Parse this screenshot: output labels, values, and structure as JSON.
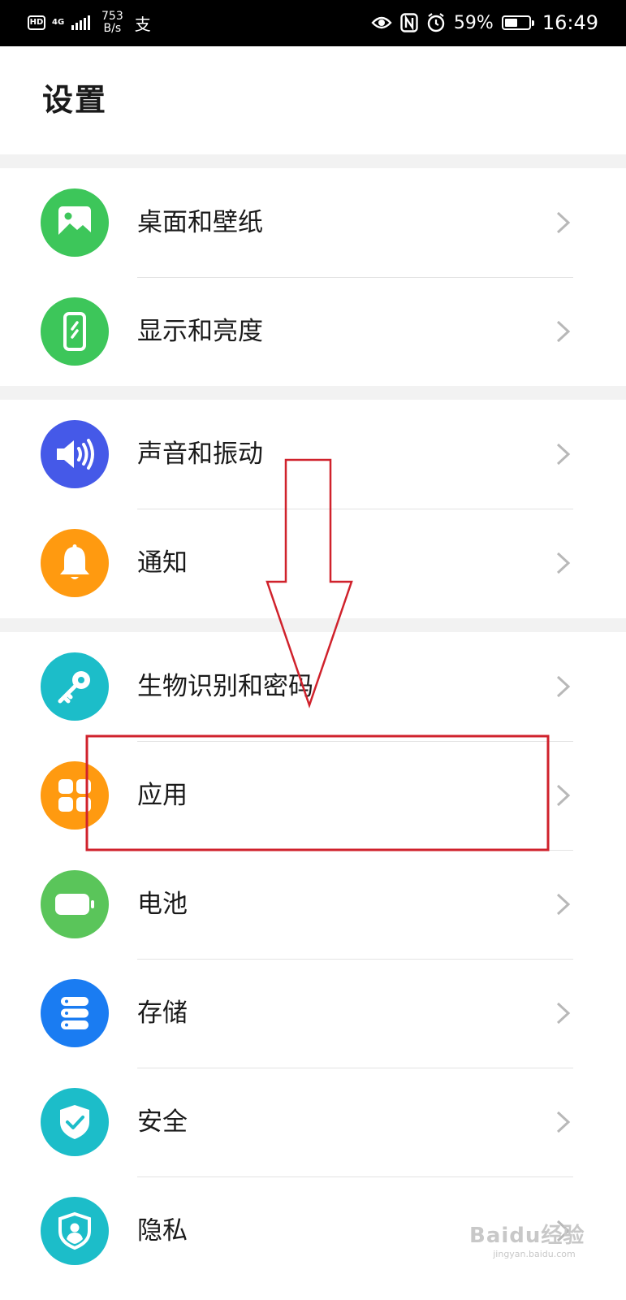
{
  "status_bar": {
    "hd_label": "HD",
    "network_label": "4G",
    "speed_value": "753",
    "speed_unit": "B/s",
    "alipay_glyph": "支",
    "battery_text": "59%",
    "battery_level": 0.59,
    "time": "16:49",
    "icons": [
      "eye-icon",
      "nfc-icon",
      "alarm-icon",
      "battery-icon"
    ]
  },
  "page": {
    "title": "设置"
  },
  "settings": [
    {
      "label": "桌面和壁纸",
      "icon": "image-icon",
      "color": "#3dc65a"
    },
    {
      "label": "显示和亮度",
      "icon": "phone-display-icon",
      "color": "#3dc65a"
    },
    {
      "label": "声音和振动",
      "icon": "speaker-icon",
      "color": "#4559e8"
    },
    {
      "label": "通知",
      "icon": "bell-icon",
      "color": "#ff9a10"
    },
    {
      "label": "生物识别和密码",
      "icon": "key-icon",
      "color": "#1cbdc9"
    },
    {
      "label": "应用",
      "icon": "apps-grid-icon",
      "color": "#ff9a10"
    },
    {
      "label": "电池",
      "icon": "battery-icon",
      "color": "#5ac55a"
    },
    {
      "label": "存储",
      "icon": "storage-icon",
      "color": "#1a7cf2"
    },
    {
      "label": "安全",
      "icon": "shield-check-icon",
      "color": "#1cbdc9"
    },
    {
      "label": "隐私",
      "icon": "privacy-user-icon",
      "color": "#1cbdc9"
    }
  ],
  "annotation": {
    "color": "#d0222c"
  },
  "watermark": {
    "main": "Baidu经验",
    "url": "jingyan.baidu.com"
  }
}
